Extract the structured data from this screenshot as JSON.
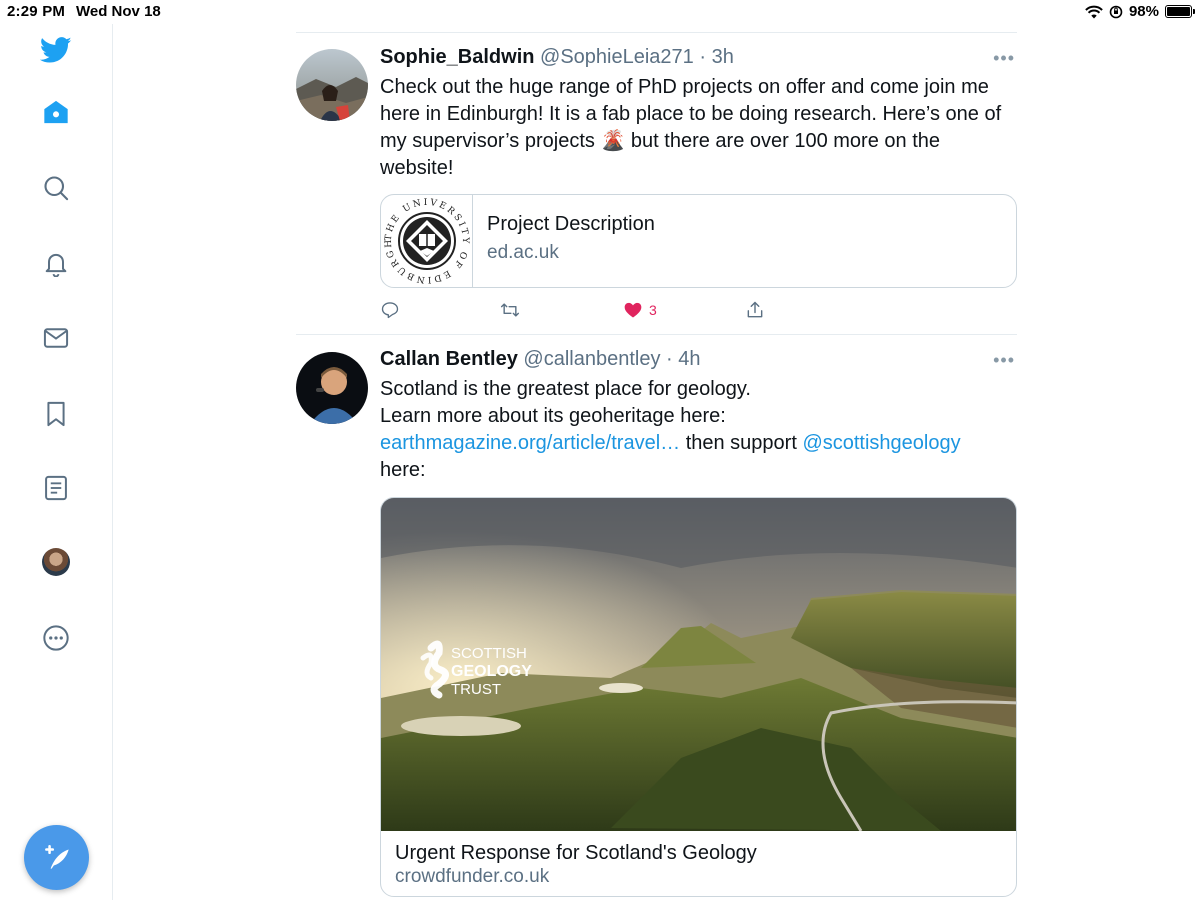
{
  "status_bar": {
    "time": "2:29 PM",
    "date": "Wed Nov 18",
    "battery_pct": "98%",
    "battery_level": 0.98
  },
  "sidebar": {
    "items": [
      {
        "name": "twitter-logo-icon"
      },
      {
        "name": "home-icon"
      },
      {
        "name": "search-icon"
      },
      {
        "name": "bell-icon"
      },
      {
        "name": "mail-icon"
      },
      {
        "name": "bookmark-icon"
      },
      {
        "name": "list-icon"
      },
      {
        "name": "profile-avatar"
      },
      {
        "name": "more-icon"
      }
    ],
    "compose_icon": "compose-feather-icon"
  },
  "colors": {
    "accent": "#1da1f2",
    "link": "#1b95e0",
    "like": "#e0245e",
    "muted": "#5b7083",
    "compose": "#4a99e9"
  },
  "tweets": [
    {
      "name": "Sophie_Baldwin",
      "handle": "@SophieLeia271",
      "time_sep": " · ",
      "time": "3h",
      "text_1": "Check out the huge range of PhD projects on offer and come join me here in Edinburgh! It is a fab place to be doing research. Here’s one of my supervisor’s projects ",
      "emoji": "🌋",
      "text_2": " but there are over 100 more on the website!",
      "card": {
        "title": "Project Description",
        "domain": "ed.ac.uk",
        "seal_text": "THE UNIVERSITY OF EDINBURGH"
      },
      "likes": "3"
    },
    {
      "name": "Callan Bentley",
      "handle": "@callanbentley",
      "time_sep": " · ",
      "time": "4h",
      "line_1": "Scotland is the greatest place for geology.",
      "line_2": "Learn more about its geoheritage here:",
      "link_1": "earthmagazine.org/article/travel…",
      "mid_text": " then support ",
      "link_2": "@scottishgeology",
      "line_4": "here:",
      "media": {
        "logo_line_1": "SCOTTISH",
        "logo_line_2": "GEOLOGY",
        "logo_line_3": "TRUST",
        "title": "Urgent Response for Scotland's Geology",
        "domain": "crowdfunder.co.uk"
      }
    }
  ]
}
